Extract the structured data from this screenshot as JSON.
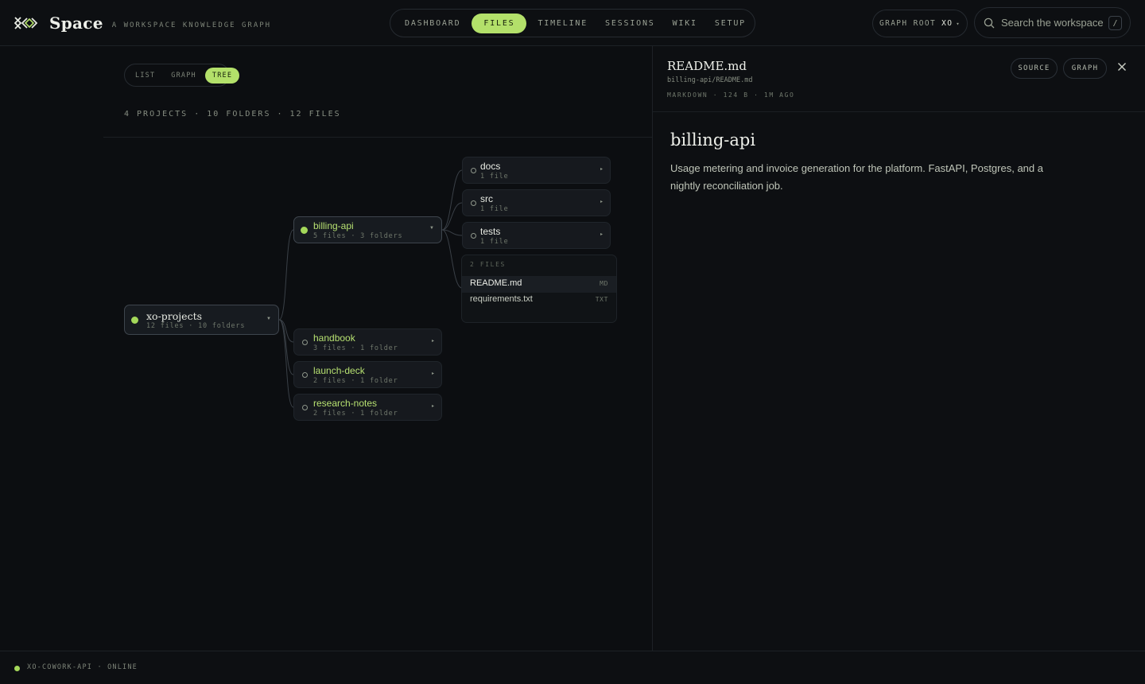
{
  "app": {
    "name": "Space",
    "tagline": "A WORKSPACE KNOWLEDGE GRAPH"
  },
  "nav": {
    "items": [
      {
        "label": "DASHBOARD"
      },
      {
        "label": "FILES",
        "active": true
      },
      {
        "label": "TIMELINE"
      },
      {
        "label": "SESSIONS"
      },
      {
        "label": "WIKI"
      },
      {
        "label": "SETUP"
      }
    ]
  },
  "graph_root": {
    "label": "GRAPH ROOT",
    "value": "XO"
  },
  "search": {
    "placeholder": "Search the workspace…",
    "shortcut": "/"
  },
  "view_toggle": {
    "items": [
      "LIST",
      "GRAPH",
      "TREE"
    ],
    "active": "TREE"
  },
  "counts": "4 PROJECTS · 10 FOLDERS · 12 FILES",
  "tree": {
    "root": {
      "name": "xo-projects",
      "meta": "12 files · 10 folders"
    },
    "projects": [
      {
        "name": "billing-api",
        "meta": "5 files · 3 folders",
        "expanded": true
      },
      {
        "name": "handbook",
        "meta": "3 files · 1 folder"
      },
      {
        "name": "launch-deck",
        "meta": "2 files · 1 folder"
      },
      {
        "name": "research-notes",
        "meta": "2 files · 1 folder"
      }
    ],
    "folders": [
      {
        "name": "docs",
        "meta": "1 file"
      },
      {
        "name": "src",
        "meta": "1 file"
      },
      {
        "name": "tests",
        "meta": "1 file"
      }
    ],
    "files_panel": {
      "heading": "2 FILES",
      "files": [
        {
          "name": "README.md",
          "type": "MD",
          "active": true
        },
        {
          "name": "requirements.txt",
          "type": "TXT"
        }
      ]
    }
  },
  "preview": {
    "title": "README.md",
    "path": "billing-api/README.md",
    "meta": "MARKDOWN · 124 B · 1M AGO",
    "buttons": {
      "source": "SOURCE",
      "graph": "GRAPH"
    },
    "doc_heading": "billing-api",
    "doc_body": "Usage metering and invoice generation for the platform. FastAPI, Postgres, and a nightly reconciliation job."
  },
  "footer": {
    "status": "XO-COWORK-API · ONLINE"
  },
  "colors": {
    "accent": "#b3e06a",
    "background": "#0c0e11",
    "panel": "#16191e"
  }
}
